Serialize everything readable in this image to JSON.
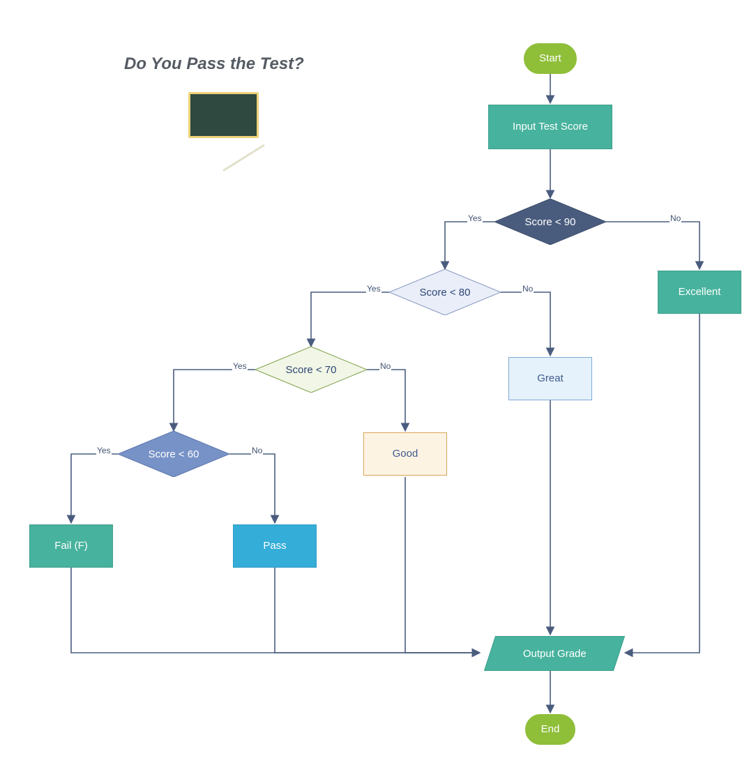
{
  "title": "Do You Pass the Test?",
  "nodes": {
    "start": {
      "label": "Start"
    },
    "input": {
      "label": "Input Test Score"
    },
    "d90": {
      "label": "Score < 90"
    },
    "d80": {
      "label": "Score < 80"
    },
    "d70": {
      "label": "Score < 70"
    },
    "d60": {
      "label": "Score < 60"
    },
    "excellent": {
      "label": "Excellent"
    },
    "great": {
      "label": "Great"
    },
    "good": {
      "label": "Good"
    },
    "pass": {
      "label": "Pass"
    },
    "fail": {
      "label": "Fail (F)"
    },
    "output": {
      "label": "Output Grade"
    },
    "end": {
      "label": "End"
    }
  },
  "edge_labels": {
    "yes": "Yes",
    "no": "No"
  },
  "edges_description": [
    "Start → Input Test Score",
    "Input Test Score → Score < 90",
    "Score < 90 —No→ Excellent",
    "Score < 90 —Yes→ Score < 80",
    "Score < 80 —No→ Great",
    "Score < 80 —Yes→ Score < 70",
    "Score < 70 —No→ Good",
    "Score < 70 —Yes→ Score < 60",
    "Score < 60 —No→ Pass",
    "Score < 60 —Yes→ Fail (F)",
    "Excellent → Output Grade",
    "Great → Output Grade",
    "Good → Output Grade",
    "Pass → Output Grade",
    "Fail (F) → Output Grade",
    "Output Grade → End"
  ]
}
